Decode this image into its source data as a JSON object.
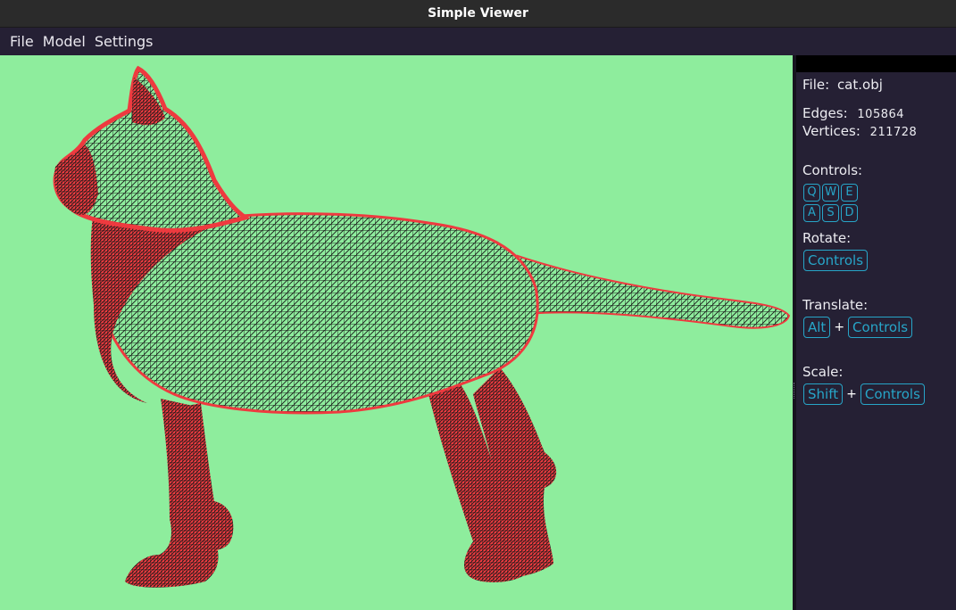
{
  "window": {
    "title": "Simple Viewer"
  },
  "menu": {
    "items": [
      "File",
      "Model",
      "Settings"
    ]
  },
  "viewport": {
    "background": "#8eed9d",
    "mesh_color": "#ee3a3f",
    "wire_color": "#111111"
  },
  "panel": {
    "file_label": "File:",
    "file_name": "cat.obj",
    "edges_label": "Edges:",
    "edges_value": "105864",
    "vertices_label": "Vertices:",
    "vertices_value": "211728",
    "controls_label": "Controls:",
    "controls_keys_row1": [
      "Q",
      "W",
      "E"
    ],
    "controls_keys_row2": [
      "A",
      "S",
      "D"
    ],
    "rotate_label": "Rotate:",
    "rotate_key": "Controls",
    "translate_label": "Translate:",
    "translate_mod": "Alt",
    "translate_key": "Controls",
    "scale_label": "Scale:",
    "scale_mod": "Shift",
    "scale_key": "Controls",
    "plus": "+",
    "accent": "#27a5c8"
  }
}
